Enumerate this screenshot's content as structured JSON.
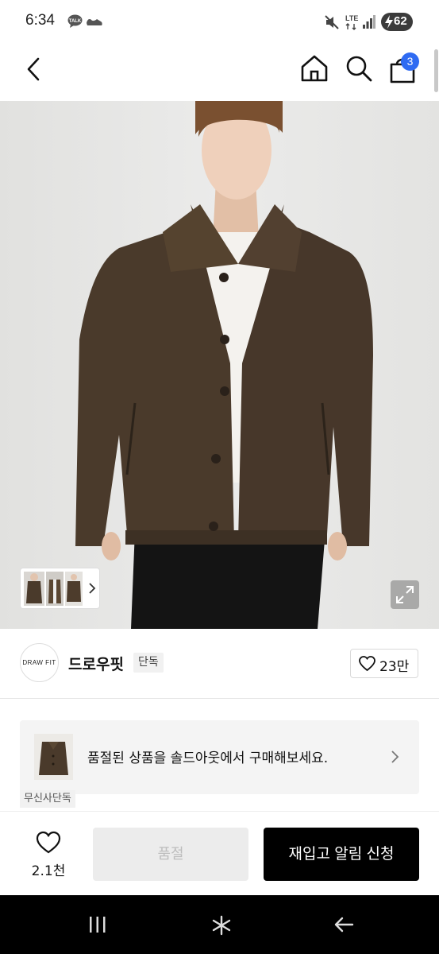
{
  "status_bar": {
    "time": "6:34",
    "battery": "62",
    "icons": [
      "talk-icon",
      "shoe-icon",
      "mute-icon",
      "lte-icon",
      "signal-icon",
      "battery-charging-icon"
    ]
  },
  "nav": {
    "icons": [
      "back-icon",
      "home-icon",
      "search-icon",
      "cart-icon"
    ],
    "cart_badge": "3"
  },
  "gallery": {
    "thumbnail_count": 3,
    "icons": [
      "chevron-right-icon",
      "expand-icon"
    ]
  },
  "brand": {
    "logo_text": "DRAW FIT",
    "name": "드로우핏",
    "badge": "단독",
    "like_count": "23만"
  },
  "banner": {
    "text": "품절된 상품을 솔드아웃에서 구매해보세요.",
    "tag": "무신사단독"
  },
  "actions": {
    "wishlist_count": "2.1천",
    "soldout_label": "품절",
    "restock_label": "재입고 알림 신청"
  },
  "colors": {
    "accent": "#2f6bf2",
    "jacket": "#4a3a2b",
    "primary_button": "#000000",
    "disabled_button": "#ececec"
  }
}
